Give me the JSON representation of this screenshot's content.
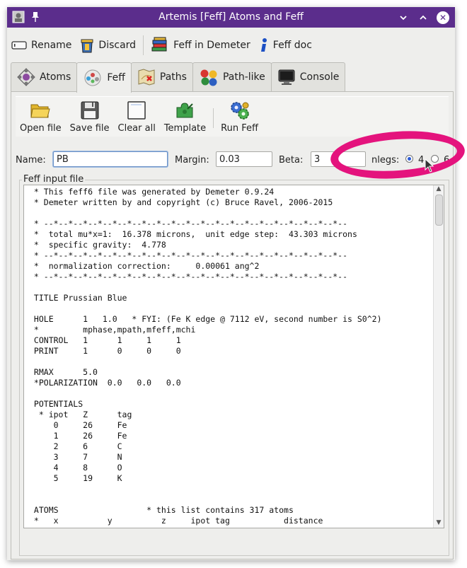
{
  "window": {
    "title": "Artemis [Feff] Atoms and Feff"
  },
  "toolbar": {
    "rename": "Rename",
    "discard": "Discard",
    "feff_in_demeter": "Feff in Demeter",
    "feff_doc": "Feff doc"
  },
  "tabs": [
    {
      "label": "Atoms"
    },
    {
      "label": "Feff"
    },
    {
      "label": "Paths"
    },
    {
      "label": "Path-like"
    },
    {
      "label": "Console"
    }
  ],
  "feff_toolbar": {
    "open_file": "Open file",
    "save_file": "Save file",
    "clear_all": "Clear all",
    "template": "Template",
    "run_feff": "Run Feff"
  },
  "params": {
    "name_label": "Name:",
    "name_value": "PB",
    "margin_label": "Margin:",
    "margin_value": "0.03",
    "beta_label": "Beta:",
    "beta_value": "3",
    "nlegs_label": "nlegs:",
    "nlegs_options": [
      "4",
      "6"
    ],
    "nlegs_selected": "4"
  },
  "input_file": {
    "label": "Feff input file",
    "lines": [
      " * This feff6 file was generated by Demeter 0.9.24",
      " * Demeter written by and copyright (c) Bruce Ravel, 2006-2015",
      "",
      " * --*--*--*--*--*--*--*--*--*--*--*--*--*--*--*--*--*--*--*--*--",
      " *  total mu*x=1:  16.378 microns,  unit edge step:  43.303 microns",
      " *  specific gravity:  4.778",
      " * --*--*--*--*--*--*--*--*--*--*--*--*--*--*--*--*--*--*--*--*--",
      " *  normalization correction:     0.00061 ang^2",
      " * --*--*--*--*--*--*--*--*--*--*--*--*--*--*--*--*--*--*--*--*--",
      "",
      " TITLE Prussian Blue",
      "",
      " HOLE      1   1.0   * FYI: (Fe K edge @ 7112 eV, second number is S0^2)",
      " *         mphase,mpath,mfeff,mchi",
      " CONTROL   1      1     1     1",
      " PRINT     1      0     0     0",
      "",
      " RMAX      5.0",
      " *POLARIZATION  0.0   0.0   0.0",
      "",
      " POTENTIALS",
      "  * ipot   Z      tag",
      "     0     26     Fe",
      "     1     26     Fe",
      "     2     6      C",
      "     3     7      N",
      "     4     8      O",
      "     5     19     K",
      "",
      "",
      " ATOMS                  * this list contains 317 atoms",
      " *   x          y          z     ipot tag           distance"
    ]
  },
  "colors": {
    "titlebar": "#5b2d8c",
    "highlight": "#e4137d",
    "radio": "#2a5bd7"
  }
}
